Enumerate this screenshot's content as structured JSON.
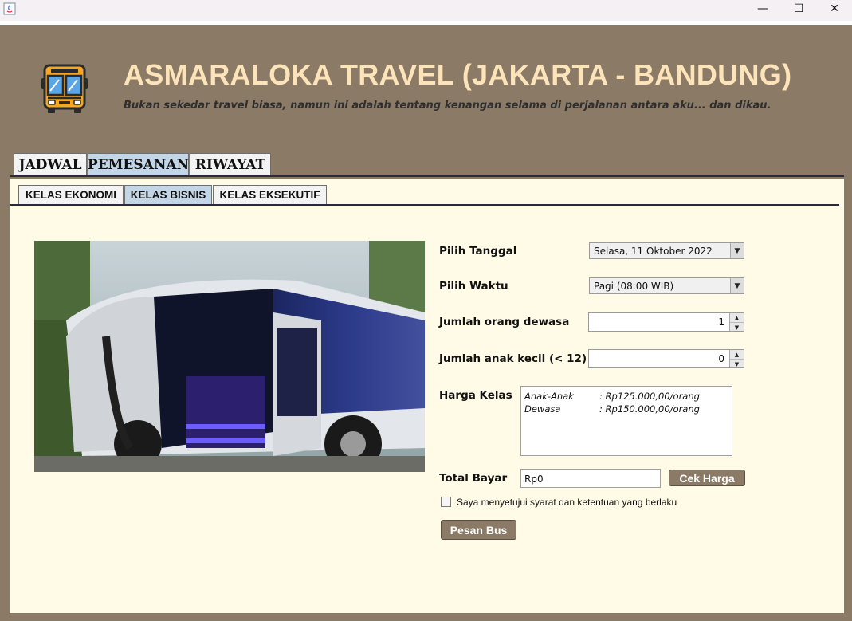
{
  "window": {
    "title": "",
    "minimize_glyph": "—",
    "maximize_glyph": "☐",
    "close_glyph": "✕"
  },
  "header": {
    "title": "ASMARALOKA TRAVEL (JAKARTA - BANDUNG)",
    "tagline": "Bukan sekedar travel biasa, namun ini adalah tentang kenangan selama di perjalanan antara aku... dan dikau.",
    "logo_icon": "bus-icon"
  },
  "main_tabs": [
    {
      "label": "JADWAL",
      "active": false
    },
    {
      "label": "PEMESANAN",
      "active": true
    },
    {
      "label": "RIWAYAT",
      "active": false
    }
  ],
  "sub_tabs": [
    {
      "label": "KELAS EKONOMI",
      "active": false
    },
    {
      "label": "KELAS BISNIS",
      "active": true
    },
    {
      "label": "KELAS EKSEKUTIF",
      "active": false
    }
  ],
  "form": {
    "date_label": "Pilih Tanggal",
    "date_value": "Selasa, 11 Oktober 2022",
    "time_label": "Pilih Waktu",
    "time_value": "Pagi (08:00 WIB)",
    "adults_label": "Jumlah orang dewasa",
    "adults_value": "1",
    "children_label": "Jumlah anak kecil (< 12)",
    "children_value": "0",
    "price_label": "Harga Kelas",
    "prices": [
      {
        "name": "Anak-Anak",
        "value": ": Rp125.000,00/orang"
      },
      {
        "name": "Dewasa",
        "value": ": Rp150.000,00/orang"
      }
    ],
    "total_label": "Total Bayar",
    "total_value": "Rp0",
    "check_price_button": "Cek Harga",
    "agree_label": "Saya menyetujui syarat dan ketentuan yang berlaku",
    "agree_checked": false,
    "order_button": "Pesan Bus"
  },
  "colors": {
    "frame": "#8b7b66",
    "title": "#fde3ba",
    "content_bg": "#fffbe6",
    "active_tab": "#c3d6e8"
  }
}
